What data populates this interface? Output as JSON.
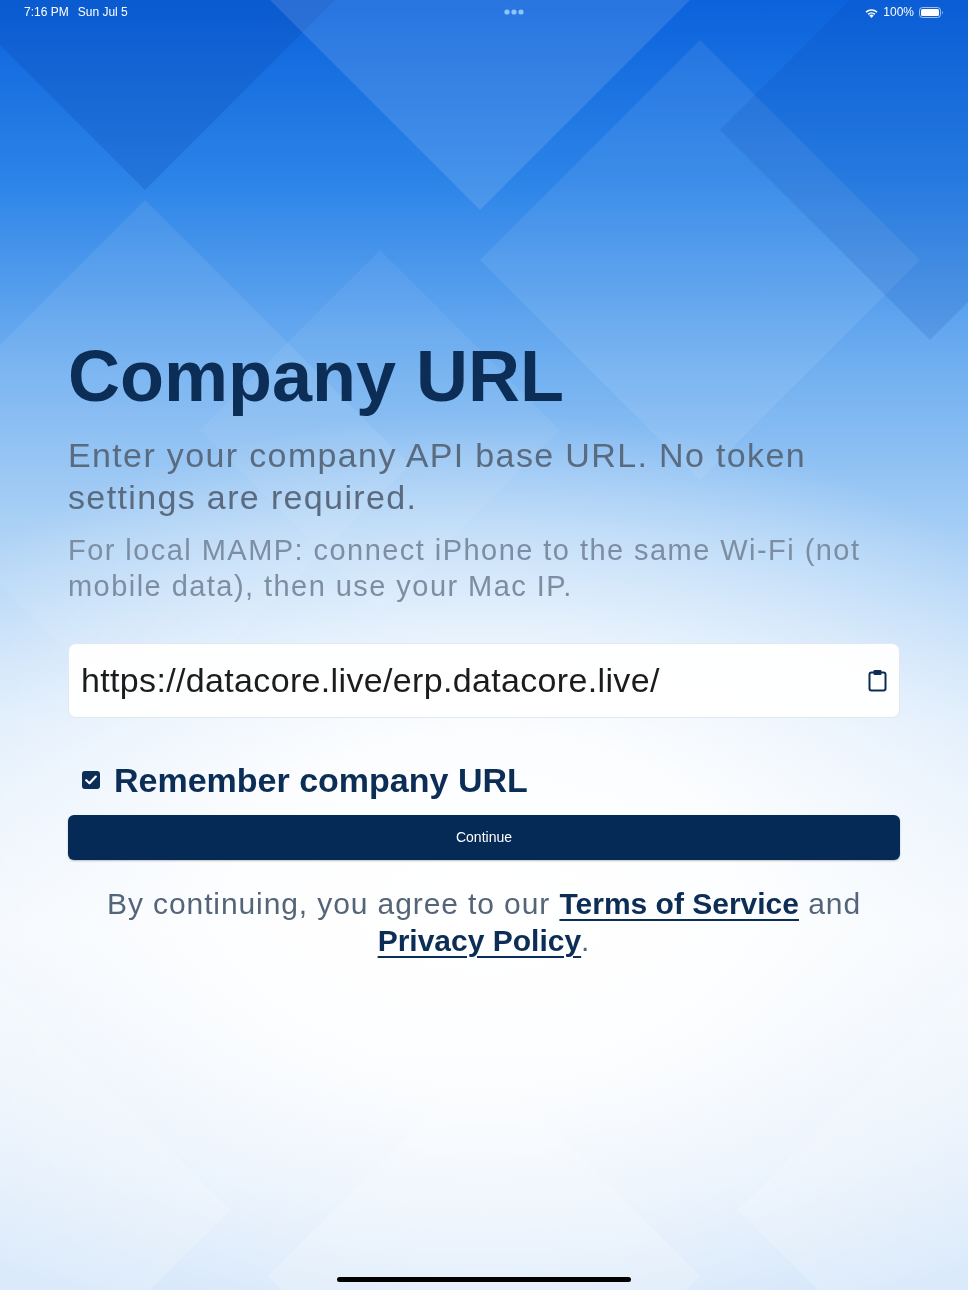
{
  "status_bar": {
    "time": "7:16 PM",
    "date": "Sun Jul 5",
    "battery": "100%"
  },
  "title": "Company URL",
  "description": "Enter your company API base URL. No token settings are required.",
  "hint": "For local MAMP: connect iPhone to the same Wi-Fi (not mobile data), then use your Mac IP.",
  "url_field": {
    "value": "https://datacore.live/erp.datacore.live/"
  },
  "remember": {
    "label": "Remember company URL",
    "checked": true
  },
  "continue_button": {
    "label": "Continue"
  },
  "legal": {
    "text_before": "By continuing, you agree to our",
    "terms_link": "Terms of Service",
    "text_middle": "and",
    "privacy_link": "Privacy Policy",
    "text_after": "."
  }
}
